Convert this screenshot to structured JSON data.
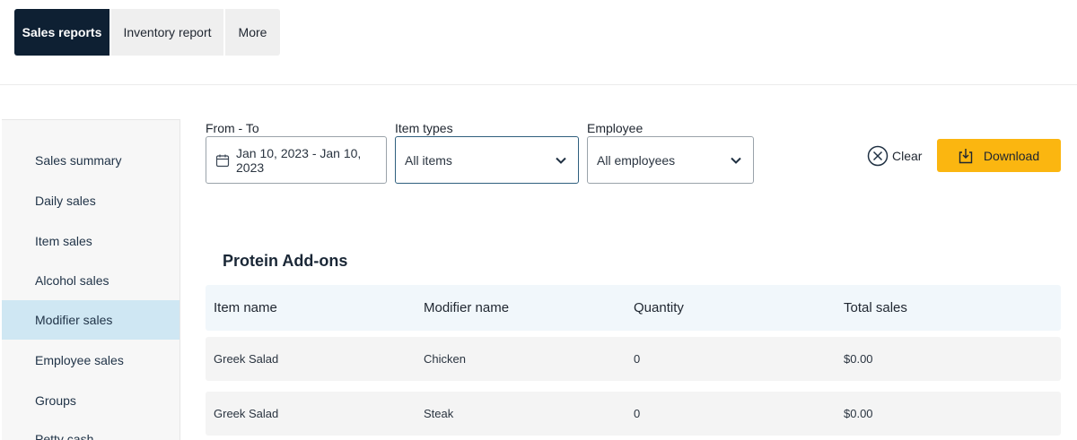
{
  "tabs": [
    {
      "label": "Sales reports",
      "active": true
    },
    {
      "label": "Inventory report",
      "active": false
    },
    {
      "label": "More",
      "active": false
    }
  ],
  "sidebar": {
    "items": [
      {
        "label": "Sales summary"
      },
      {
        "label": "Daily sales"
      },
      {
        "label": "Item sales"
      },
      {
        "label": "Alcohol sales"
      },
      {
        "label": "Modifier sales",
        "active": true
      },
      {
        "label": "Employee sales"
      },
      {
        "label": "Groups"
      },
      {
        "label": "Petty cash"
      }
    ]
  },
  "filters": {
    "date": {
      "label": "From - To",
      "value": "Jan 10, 2023 - Jan 10, 2023",
      "icon": "calendar-icon"
    },
    "item_types": {
      "label": "Item types",
      "value": "All items",
      "icon": "chevron-down-icon"
    },
    "employee": {
      "label": "Employee",
      "value": "All employees",
      "icon": "chevron-down-icon"
    }
  },
  "actions": {
    "clear_label": "Clear",
    "download_label": "Download",
    "download_color": "#fbb610"
  },
  "table": {
    "title": "Protein Add-ons",
    "columns": [
      "Item name",
      "Modifier name",
      "Quantity",
      "Total sales"
    ],
    "rows": [
      [
        "Greek Salad",
        "Chicken",
        "0",
        "$0.00"
      ],
      [
        "Greek Salad",
        "Steak",
        "0",
        "$0.00"
      ]
    ]
  },
  "colors": {
    "active_tab": "#0e2033",
    "active_sidebar": "#cfe7f3"
  }
}
